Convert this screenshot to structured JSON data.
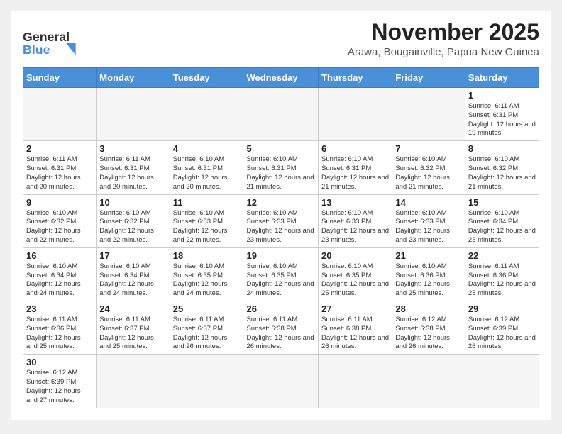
{
  "header": {
    "logo_general": "General",
    "logo_blue": "Blue",
    "month_title": "November 2025",
    "location": "Arawa, Bougainville, Papua New Guinea"
  },
  "weekdays": [
    "Sunday",
    "Monday",
    "Tuesday",
    "Wednesday",
    "Thursday",
    "Friday",
    "Saturday"
  ],
  "weeks": [
    [
      {
        "day": "",
        "info": ""
      },
      {
        "day": "",
        "info": ""
      },
      {
        "day": "",
        "info": ""
      },
      {
        "day": "",
        "info": ""
      },
      {
        "day": "",
        "info": ""
      },
      {
        "day": "",
        "info": ""
      },
      {
        "day": "1",
        "info": "Sunrise: 6:11 AM\nSunset: 6:31 PM\nDaylight: 12 hours and 19 minutes."
      }
    ],
    [
      {
        "day": "2",
        "info": "Sunrise: 6:11 AM\nSunset: 6:31 PM\nDaylight: 12 hours and 20 minutes."
      },
      {
        "day": "3",
        "info": "Sunrise: 6:11 AM\nSunset: 6:31 PM\nDaylight: 12 hours and 20 minutes."
      },
      {
        "day": "4",
        "info": "Sunrise: 6:10 AM\nSunset: 6:31 PM\nDaylight: 12 hours and 20 minutes."
      },
      {
        "day": "5",
        "info": "Sunrise: 6:10 AM\nSunset: 6:31 PM\nDaylight: 12 hours and 21 minutes."
      },
      {
        "day": "6",
        "info": "Sunrise: 6:10 AM\nSunset: 6:31 PM\nDaylight: 12 hours and 21 minutes."
      },
      {
        "day": "7",
        "info": "Sunrise: 6:10 AM\nSunset: 6:32 PM\nDaylight: 12 hours and 21 minutes."
      },
      {
        "day": "8",
        "info": "Sunrise: 6:10 AM\nSunset: 6:32 PM\nDaylight: 12 hours and 21 minutes."
      }
    ],
    [
      {
        "day": "9",
        "info": "Sunrise: 6:10 AM\nSunset: 6:32 PM\nDaylight: 12 hours and 22 minutes."
      },
      {
        "day": "10",
        "info": "Sunrise: 6:10 AM\nSunset: 6:32 PM\nDaylight: 12 hours and 22 minutes."
      },
      {
        "day": "11",
        "info": "Sunrise: 6:10 AM\nSunset: 6:33 PM\nDaylight: 12 hours and 22 minutes."
      },
      {
        "day": "12",
        "info": "Sunrise: 6:10 AM\nSunset: 6:33 PM\nDaylight: 12 hours and 23 minutes."
      },
      {
        "day": "13",
        "info": "Sunrise: 6:10 AM\nSunset: 6:33 PM\nDaylight: 12 hours and 23 minutes."
      },
      {
        "day": "14",
        "info": "Sunrise: 6:10 AM\nSunset: 6:33 PM\nDaylight: 12 hours and 23 minutes."
      },
      {
        "day": "15",
        "info": "Sunrise: 6:10 AM\nSunset: 6:34 PM\nDaylight: 12 hours and 23 minutes."
      }
    ],
    [
      {
        "day": "16",
        "info": "Sunrise: 6:10 AM\nSunset: 6:34 PM\nDaylight: 12 hours and 24 minutes."
      },
      {
        "day": "17",
        "info": "Sunrise: 6:10 AM\nSunset: 6:34 PM\nDaylight: 12 hours and 24 minutes."
      },
      {
        "day": "18",
        "info": "Sunrise: 6:10 AM\nSunset: 6:35 PM\nDaylight: 12 hours and 24 minutes."
      },
      {
        "day": "19",
        "info": "Sunrise: 6:10 AM\nSunset: 6:35 PM\nDaylight: 12 hours and 24 minutes."
      },
      {
        "day": "20",
        "info": "Sunrise: 6:10 AM\nSunset: 6:35 PM\nDaylight: 12 hours and 25 minutes."
      },
      {
        "day": "21",
        "info": "Sunrise: 6:10 AM\nSunset: 6:36 PM\nDaylight: 12 hours and 25 minutes."
      },
      {
        "day": "22",
        "info": "Sunrise: 6:11 AM\nSunset: 6:36 PM\nDaylight: 12 hours and 25 minutes."
      }
    ],
    [
      {
        "day": "23",
        "info": "Sunrise: 6:11 AM\nSunset: 6:36 PM\nDaylight: 12 hours and 25 minutes."
      },
      {
        "day": "24",
        "info": "Sunrise: 6:11 AM\nSunset: 6:37 PM\nDaylight: 12 hours and 25 minutes."
      },
      {
        "day": "25",
        "info": "Sunrise: 6:11 AM\nSunset: 6:37 PM\nDaylight: 12 hours and 26 minutes."
      },
      {
        "day": "26",
        "info": "Sunrise: 6:11 AM\nSunset: 6:38 PM\nDaylight: 12 hours and 26 minutes."
      },
      {
        "day": "27",
        "info": "Sunrise: 6:11 AM\nSunset: 6:38 PM\nDaylight: 12 hours and 26 minutes."
      },
      {
        "day": "28",
        "info": "Sunrise: 6:12 AM\nSunset: 6:38 PM\nDaylight: 12 hours and 26 minutes."
      },
      {
        "day": "29",
        "info": "Sunrise: 6:12 AM\nSunset: 6:39 PM\nDaylight: 12 hours and 26 minutes."
      }
    ],
    [
      {
        "day": "30",
        "info": "Sunrise: 6:12 AM\nSunset: 6:39 PM\nDaylight: 12 hours and 27 minutes."
      },
      {
        "day": "",
        "info": ""
      },
      {
        "day": "",
        "info": ""
      },
      {
        "day": "",
        "info": ""
      },
      {
        "day": "",
        "info": ""
      },
      {
        "day": "",
        "info": ""
      },
      {
        "day": "",
        "info": ""
      }
    ]
  ]
}
